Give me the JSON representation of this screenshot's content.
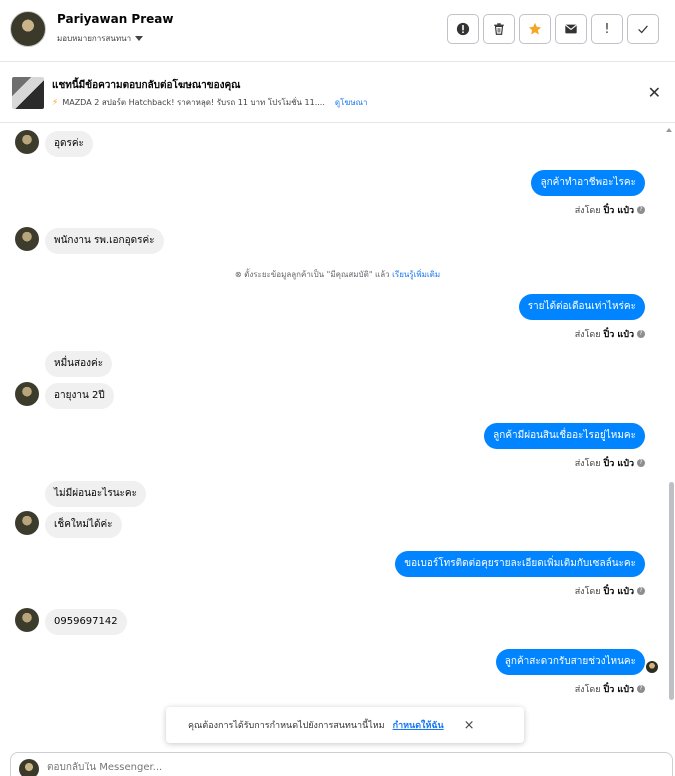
{
  "header": {
    "name": "Pariyawan Preaw",
    "assign_label": "มอบหมายการสนทนา",
    "actions": {
      "spam": "!",
      "delete": "🗑",
      "star": "★",
      "mail": "✉",
      "alert": "!",
      "done": "✓"
    },
    "star_color": "#f5a623"
  },
  "ad": {
    "title": "แชทนี้มีข้อความตอบกลับต่อโฆษณาของคุณ",
    "subtitle": "MAZDA 2 สปอร์ต Hatchback! ราคาหลุด! รับรถ 11 บาท โปรโมชั่น 11....",
    "link": "ดูโฆษณา"
  },
  "messages": {
    "m1": "อุดรค่ะ",
    "m2": "ลูกค้าทำอาชีพอะไรคะ",
    "m3": "พนักงาน รพ.เอกอุดรค่ะ",
    "sys_note": "ตั้งระยะข้อมูลลูกค้าเป็น \"มีคุณสมบัติ\" แล้ว",
    "sys_link": "เรียนรู้เพิ่มเติม",
    "m4": "รายได้ต่อเดือนเท่าไหร่คะ",
    "m5": "หมื่นสองค่ะ",
    "m6": "อายุงาน 2ปี",
    "m7": "ลูกค้ามีผ่อนสินเชื่ออะไรอยู่ไหมคะ",
    "m8": "ไม่มีผ่อนอะไรนะคะ",
    "m9": "เช็คใหม่ได้ค่ะ",
    "m10": "ขอเบอร์โทรติดต่อคุยรายละเอียดเพิ่มเติมกับเซลล์นะคะ",
    "m11": "0959697142",
    "m12": "ลูกค้าสะดวกรับสายช่วงไหนคะ",
    "sent_prefix": "ส่งโดย",
    "sender": "ปิ๋ว แป๋ว",
    "help": "?"
  },
  "toast": {
    "text": "คุณต้องการได้รับการกำหนดไปยังการสนทนานี้ไหม",
    "link": "กำหนดให้ฉัน",
    "close": "×"
  },
  "composer": {
    "placeholder": "ตอบกลับใน Messenger..."
  },
  "colors": {
    "outgoing_bubble": "#0084ff",
    "incoming_bubble": "#f0f0f0",
    "link": "#1877f2"
  }
}
